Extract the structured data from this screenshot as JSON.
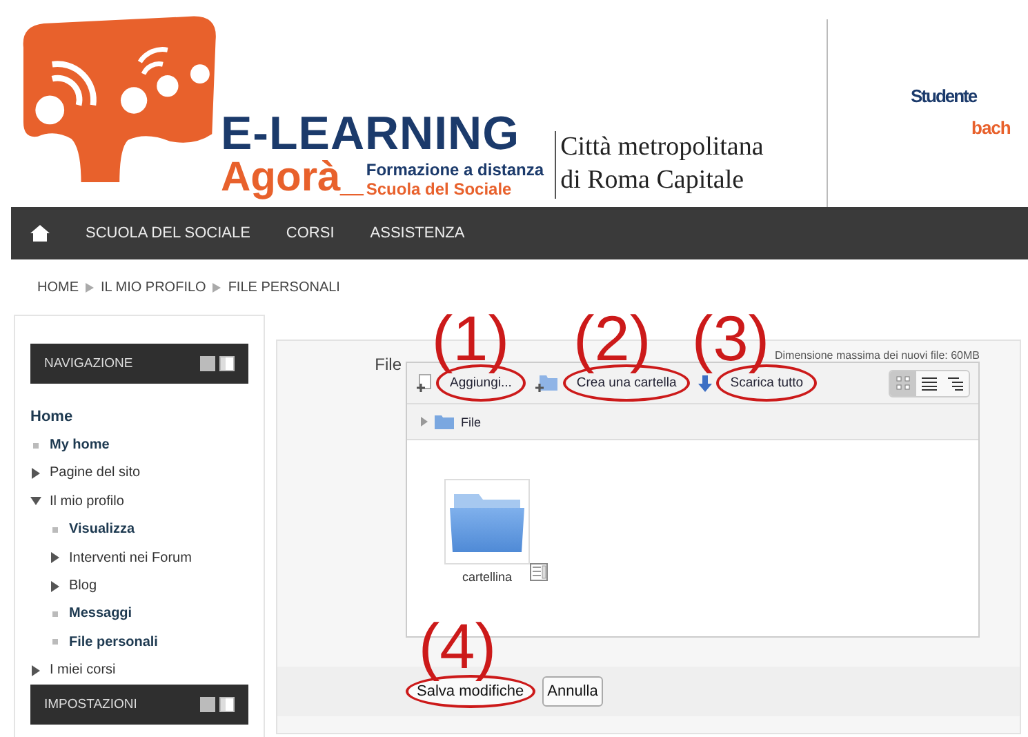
{
  "header": {
    "logo": {
      "title": "E-LEARNING",
      "brand": "Agorà_",
      "tagline": "Formazione a distanza",
      "subtitle": "Scuola del Sociale"
    },
    "partner": [
      "Città metropolitana",
      "di Roma Capitale"
    ],
    "user": {
      "role": "Studente",
      "name": "bach"
    }
  },
  "nav": {
    "items": [
      "SCUOLA DEL SOCIALE",
      "CORSI",
      "ASSISTENZA"
    ]
  },
  "breadcrumb": [
    "HOME",
    "IL MIO PROFILO",
    "FILE PERSONALI"
  ],
  "sidebar": {
    "blocks": [
      {
        "title": "NAVIGAZIONE",
        "tree": [
          {
            "label": "Home",
            "kind": "root",
            "children": [
              {
                "label": "My home",
                "kind": "leaf"
              },
              {
                "label": "Pagine del sito",
                "kind": "branch",
                "expanded": false
              },
              {
                "label": "Il mio profilo",
                "kind": "branch",
                "expanded": true,
                "children": [
                  {
                    "label": "Visualizza",
                    "kind": "leaf"
                  },
                  {
                    "label": "Interventi nei Forum",
                    "kind": "branch",
                    "expanded": false
                  },
                  {
                    "label": "Blog",
                    "kind": "branch",
                    "expanded": false
                  },
                  {
                    "label": "Messaggi",
                    "kind": "leaf"
                  },
                  {
                    "label": "File personali",
                    "kind": "leaf"
                  }
                ]
              },
              {
                "label": "I miei corsi",
                "kind": "branch",
                "expanded": false
              }
            ]
          }
        ]
      },
      {
        "title": "IMPOSTAZIONI"
      }
    ]
  },
  "file_manager": {
    "label": "File",
    "max_size": "Dimensione massima dei nuovi file: 60MB",
    "toolbar": [
      {
        "label": "Aggiungi...",
        "annotation": "(1)"
      },
      {
        "label": "Crea una cartella",
        "annotation": "(2)"
      },
      {
        "label": "Scarica tutto",
        "annotation": "(3)"
      }
    ],
    "views": [
      {
        "kind": "icons",
        "selected": true
      },
      {
        "kind": "list",
        "selected": false
      },
      {
        "kind": "tree",
        "selected": false
      }
    ],
    "path": [
      "File"
    ],
    "items": [
      {
        "name": "cartellina",
        "kind": "folder"
      }
    ]
  },
  "buttons": [
    {
      "label": "Salva modifiche",
      "annotation": "(4)"
    },
    {
      "label": "Annulla"
    }
  ]
}
